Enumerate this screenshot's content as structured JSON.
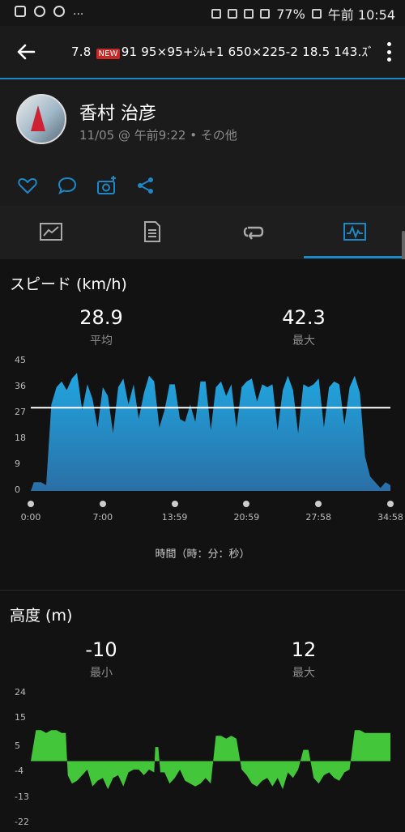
{
  "statusbar": {
    "right_text": "77%",
    "time": "午前 10:54",
    "ellipsis": "..."
  },
  "appbar": {
    "title_pre": "7.8",
    "new_badge": "NEW",
    "title_post": "91  95×95+ｼﾑ+1  650×225-2  18.5  143.ｽﾞ"
  },
  "profile": {
    "name": "香村 治彦",
    "meta": "11/05 @ 午前9:22 • その他"
  },
  "speed": {
    "title": "スピード (km/h)",
    "avg_value": "28.9",
    "avg_label": "平均",
    "max_value": "42.3",
    "max_label": "最大",
    "x_label": "時間（時：分：秒）"
  },
  "elevation": {
    "title": "高度 (m)",
    "min_value": "-10",
    "min_label": "最小",
    "max_value": "12",
    "max_label": "最大"
  },
  "colors": {
    "accent": "#1e88c7",
    "speed_fill": "#1b9bd7",
    "elev_fill": "#44c63a"
  },
  "chart_data": [
    {
      "type": "area",
      "title": "スピード (km/h)",
      "xlabel": "時間（時：分：秒）",
      "ylabel": "",
      "ylim": [
        0,
        45
      ],
      "yticks": [
        "45",
        "36",
        "27",
        "18",
        "9",
        "0"
      ],
      "xticks": [
        "0:00",
        "7:00",
        "13:59",
        "20:59",
        "27:58",
        "34:58"
      ],
      "avg_line": 28.9,
      "series": [
        {
          "x": [
            0,
            0.3,
            0.6,
            1.0,
            1.5,
            2.0,
            2.5,
            3.0,
            3.5,
            4.0,
            4.5,
            5.0,
            5.5,
            6.0,
            6.5,
            7.0,
            7.5,
            8.0,
            8.5,
            9.0,
            9.5,
            10.0,
            10.5,
            11.0,
            11.5,
            12.0,
            12.5,
            13.0,
            13.5,
            14.0,
            14.5,
            15.0,
            15.5,
            16.0,
            16.5,
            17.0,
            17.5,
            18.0,
            18.5,
            19.0,
            19.5,
            20.0,
            20.5,
            21.0,
            21.5,
            22.0,
            22.5,
            23.0,
            23.5,
            24.0,
            24.5,
            25.0,
            25.5,
            26.0,
            26.5,
            27.0,
            27.5,
            28.0,
            28.5,
            29.0,
            29.5,
            30.0,
            30.5,
            31.0,
            31.5,
            32.0,
            32.5,
            33.0,
            33.5,
            34.0,
            34.5,
            34.97
          ],
          "values": [
            0,
            3,
            3,
            3,
            2,
            30,
            36,
            38,
            35,
            39,
            41,
            28,
            37,
            32,
            22,
            36,
            33,
            20,
            36,
            39,
            30,
            37,
            25,
            34,
            40,
            38,
            22,
            28,
            37,
            37,
            25,
            24,
            30,
            24,
            38,
            38,
            21,
            36,
            38,
            33,
            37,
            22,
            36,
            38,
            39,
            31,
            37,
            36,
            37,
            21,
            35,
            40,
            35,
            20,
            37,
            36,
            37,
            39,
            22,
            36,
            38,
            37,
            23,
            36,
            40,
            34,
            12,
            5,
            3,
            1,
            3,
            2
          ]
        }
      ]
    },
    {
      "type": "area",
      "title": "高度 (m)",
      "ylim": [
        -22,
        24
      ],
      "yticks": [
        "24",
        "15",
        "5",
        "-4",
        "-13",
        "-22"
      ],
      "series": [
        {
          "x": [
            0,
            0.5,
            1.0,
            1.5,
            2.0,
            2.5,
            3.0,
            3.4,
            3.6,
            4.0,
            4.5,
            5.0,
            5.5,
            6.0,
            6.5,
            7.0,
            7.5,
            8.0,
            8.5,
            9.0,
            9.5,
            10.0,
            10.5,
            11.0,
            11.5,
            12.0,
            12.1,
            12.4,
            12.6,
            13.0,
            13.5,
            14.0,
            14.5,
            15.0,
            15.5,
            16.0,
            16.5,
            17.0,
            17.5,
            18.0,
            18.5,
            19.0,
            19.5,
            20.0,
            20.5,
            21.0,
            21.5,
            22.0,
            22.5,
            23.0,
            23.5,
            24.0,
            24.5,
            25.0,
            25.5,
            26.0,
            26.5,
            27.0,
            27.5,
            28.0,
            28.5,
            29.0,
            29.5,
            30.0,
            30.5,
            31.0,
            31.5,
            32.0,
            32.5,
            33.0,
            33.5,
            34.0,
            34.5,
            34.97
          ],
          "values": [
            0,
            11,
            11,
            10,
            11,
            11,
            10,
            10,
            -5,
            -8,
            -7,
            -5,
            -3,
            -9,
            -7,
            -6,
            -10,
            -6,
            -5,
            -9,
            -4,
            -3,
            -3,
            -5,
            -3,
            -4,
            5,
            5,
            -4,
            -4,
            -8,
            -6,
            -3,
            -7,
            -8,
            -9,
            -8,
            -6,
            -8,
            9,
            9,
            8,
            9,
            8,
            -3,
            -5,
            -8,
            -9,
            -7,
            -6,
            -9,
            -6,
            -10,
            -4,
            -6,
            -3,
            4,
            4,
            -6,
            -8,
            -5,
            -4,
            -6,
            -7,
            -4,
            -3,
            11,
            11,
            10,
            10,
            10,
            10,
            10,
            10
          ]
        }
      ]
    }
  ]
}
